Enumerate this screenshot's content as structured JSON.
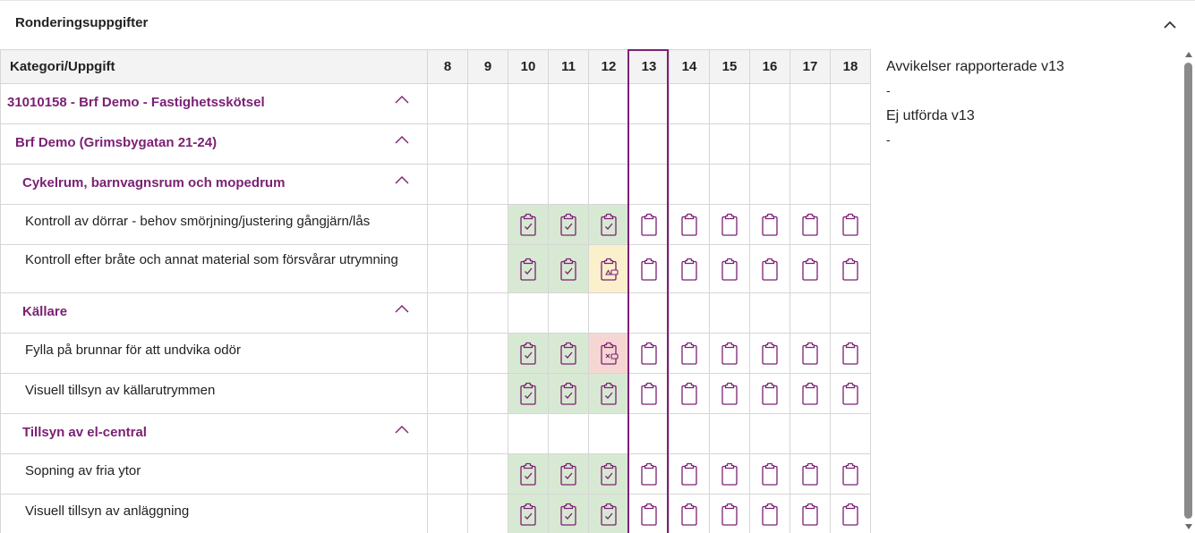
{
  "panel": {
    "title": "Ronderingsuppgifter"
  },
  "table": {
    "category_header": "Kategori/Uppgift",
    "weeks": [
      "8",
      "9",
      "10",
      "11",
      "12",
      "13",
      "14",
      "15",
      "16",
      "17",
      "18"
    ],
    "current_week": "13",
    "rows": [
      {
        "label": "31010158 - Brf Demo - Fastighetsskötsel",
        "level": 0,
        "type": "group"
      },
      {
        "label": "Brf Demo (Grimsbygatan 21-24)",
        "level": 1,
        "type": "group"
      },
      {
        "label": "Cykelrum, barnvagnsrum och mopedrum",
        "level": 2,
        "type": "group"
      },
      {
        "label": "Kontroll av dörrar - behov smörjning/justering gångjärn/lås",
        "type": "task",
        "cells": [
          "",
          "",
          "done",
          "done",
          "done",
          "todo",
          "todo",
          "todo",
          "todo",
          "todo",
          "todo"
        ]
      },
      {
        "label": "Kontroll efter bråte och annat material som försvårar utrymning",
        "type": "task",
        "cells": [
          "",
          "",
          "done",
          "done",
          "deviation",
          "todo",
          "todo",
          "todo",
          "todo",
          "todo",
          "todo"
        ]
      },
      {
        "label": "Källare",
        "level": 2,
        "type": "group"
      },
      {
        "label": "Fylla på brunnar för att undvika odör",
        "type": "task",
        "cells": [
          "",
          "",
          "done",
          "done",
          "not_done",
          "todo",
          "todo",
          "todo",
          "todo",
          "todo",
          "todo"
        ]
      },
      {
        "label": "Visuell tillsyn av källarutrymmen",
        "type": "task",
        "cells": [
          "",
          "",
          "done",
          "done",
          "done",
          "todo",
          "todo",
          "todo",
          "todo",
          "todo",
          "todo"
        ]
      },
      {
        "label": "Tillsyn av el-central",
        "level": 2,
        "type": "group"
      },
      {
        "label": "Sopning av fria ytor",
        "type": "task",
        "cells": [
          "",
          "",
          "done",
          "done",
          "done",
          "todo",
          "todo",
          "todo",
          "todo",
          "todo",
          "todo"
        ]
      },
      {
        "label": "Visuell tillsyn av anläggning",
        "type": "task",
        "cells": [
          "",
          "",
          "done",
          "done",
          "done",
          "todo",
          "todo",
          "todo",
          "todo",
          "todo",
          "todo"
        ]
      }
    ]
  },
  "side": {
    "deviations_title": "Avvikelser rapporterade v13",
    "deviations_value": "-",
    "not_done_title": "Ej utförda v13",
    "not_done_value": "-"
  },
  "icons": {
    "collapse": "chevron-up-icon",
    "done": "clipboard-check-icon",
    "todo": "clipboard-icon",
    "deviation": "clipboard-warning-comment-icon",
    "not_done": "clipboard-x-comment-icon"
  },
  "colors": {
    "accent": "#7b2174",
    "done_bg": "#d7e9d2",
    "deviation_bg": "#fbf0cc",
    "not_done_bg": "#f6d6d3"
  }
}
